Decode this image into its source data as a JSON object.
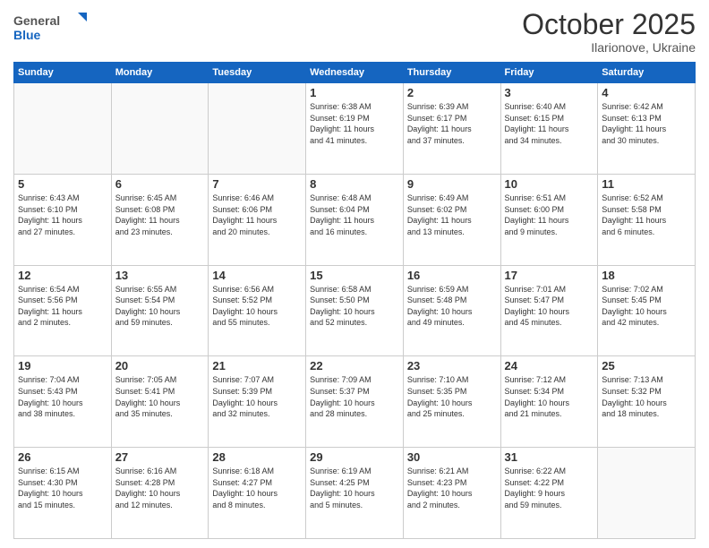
{
  "header": {
    "logo_general": "General",
    "logo_blue": "Blue",
    "month_title": "October 2025",
    "location": "Ilarionove, Ukraine"
  },
  "days_of_week": [
    "Sunday",
    "Monday",
    "Tuesday",
    "Wednesday",
    "Thursday",
    "Friday",
    "Saturday"
  ],
  "weeks": [
    [
      {
        "day": "",
        "info": ""
      },
      {
        "day": "",
        "info": ""
      },
      {
        "day": "",
        "info": ""
      },
      {
        "day": "1",
        "info": "Sunrise: 6:38 AM\nSunset: 6:19 PM\nDaylight: 11 hours\nand 41 minutes."
      },
      {
        "day": "2",
        "info": "Sunrise: 6:39 AM\nSunset: 6:17 PM\nDaylight: 11 hours\nand 37 minutes."
      },
      {
        "day": "3",
        "info": "Sunrise: 6:40 AM\nSunset: 6:15 PM\nDaylight: 11 hours\nand 34 minutes."
      },
      {
        "day": "4",
        "info": "Sunrise: 6:42 AM\nSunset: 6:13 PM\nDaylight: 11 hours\nand 30 minutes."
      }
    ],
    [
      {
        "day": "5",
        "info": "Sunrise: 6:43 AM\nSunset: 6:10 PM\nDaylight: 11 hours\nand 27 minutes."
      },
      {
        "day": "6",
        "info": "Sunrise: 6:45 AM\nSunset: 6:08 PM\nDaylight: 11 hours\nand 23 minutes."
      },
      {
        "day": "7",
        "info": "Sunrise: 6:46 AM\nSunset: 6:06 PM\nDaylight: 11 hours\nand 20 minutes."
      },
      {
        "day": "8",
        "info": "Sunrise: 6:48 AM\nSunset: 6:04 PM\nDaylight: 11 hours\nand 16 minutes."
      },
      {
        "day": "9",
        "info": "Sunrise: 6:49 AM\nSunset: 6:02 PM\nDaylight: 11 hours\nand 13 minutes."
      },
      {
        "day": "10",
        "info": "Sunrise: 6:51 AM\nSunset: 6:00 PM\nDaylight: 11 hours\nand 9 minutes."
      },
      {
        "day": "11",
        "info": "Sunrise: 6:52 AM\nSunset: 5:58 PM\nDaylight: 11 hours\nand 6 minutes."
      }
    ],
    [
      {
        "day": "12",
        "info": "Sunrise: 6:54 AM\nSunset: 5:56 PM\nDaylight: 11 hours\nand 2 minutes."
      },
      {
        "day": "13",
        "info": "Sunrise: 6:55 AM\nSunset: 5:54 PM\nDaylight: 10 hours\nand 59 minutes."
      },
      {
        "day": "14",
        "info": "Sunrise: 6:56 AM\nSunset: 5:52 PM\nDaylight: 10 hours\nand 55 minutes."
      },
      {
        "day": "15",
        "info": "Sunrise: 6:58 AM\nSunset: 5:50 PM\nDaylight: 10 hours\nand 52 minutes."
      },
      {
        "day": "16",
        "info": "Sunrise: 6:59 AM\nSunset: 5:48 PM\nDaylight: 10 hours\nand 49 minutes."
      },
      {
        "day": "17",
        "info": "Sunrise: 7:01 AM\nSunset: 5:47 PM\nDaylight: 10 hours\nand 45 minutes."
      },
      {
        "day": "18",
        "info": "Sunrise: 7:02 AM\nSunset: 5:45 PM\nDaylight: 10 hours\nand 42 minutes."
      }
    ],
    [
      {
        "day": "19",
        "info": "Sunrise: 7:04 AM\nSunset: 5:43 PM\nDaylight: 10 hours\nand 38 minutes."
      },
      {
        "day": "20",
        "info": "Sunrise: 7:05 AM\nSunset: 5:41 PM\nDaylight: 10 hours\nand 35 minutes."
      },
      {
        "day": "21",
        "info": "Sunrise: 7:07 AM\nSunset: 5:39 PM\nDaylight: 10 hours\nand 32 minutes."
      },
      {
        "day": "22",
        "info": "Sunrise: 7:09 AM\nSunset: 5:37 PM\nDaylight: 10 hours\nand 28 minutes."
      },
      {
        "day": "23",
        "info": "Sunrise: 7:10 AM\nSunset: 5:35 PM\nDaylight: 10 hours\nand 25 minutes."
      },
      {
        "day": "24",
        "info": "Sunrise: 7:12 AM\nSunset: 5:34 PM\nDaylight: 10 hours\nand 21 minutes."
      },
      {
        "day": "25",
        "info": "Sunrise: 7:13 AM\nSunset: 5:32 PM\nDaylight: 10 hours\nand 18 minutes."
      }
    ],
    [
      {
        "day": "26",
        "info": "Sunrise: 6:15 AM\nSunset: 4:30 PM\nDaylight: 10 hours\nand 15 minutes."
      },
      {
        "day": "27",
        "info": "Sunrise: 6:16 AM\nSunset: 4:28 PM\nDaylight: 10 hours\nand 12 minutes."
      },
      {
        "day": "28",
        "info": "Sunrise: 6:18 AM\nSunset: 4:27 PM\nDaylight: 10 hours\nand 8 minutes."
      },
      {
        "day": "29",
        "info": "Sunrise: 6:19 AM\nSunset: 4:25 PM\nDaylight: 10 hours\nand 5 minutes."
      },
      {
        "day": "30",
        "info": "Sunrise: 6:21 AM\nSunset: 4:23 PM\nDaylight: 10 hours\nand 2 minutes."
      },
      {
        "day": "31",
        "info": "Sunrise: 6:22 AM\nSunset: 4:22 PM\nDaylight: 9 hours\nand 59 minutes."
      },
      {
        "day": "",
        "info": ""
      }
    ]
  ]
}
